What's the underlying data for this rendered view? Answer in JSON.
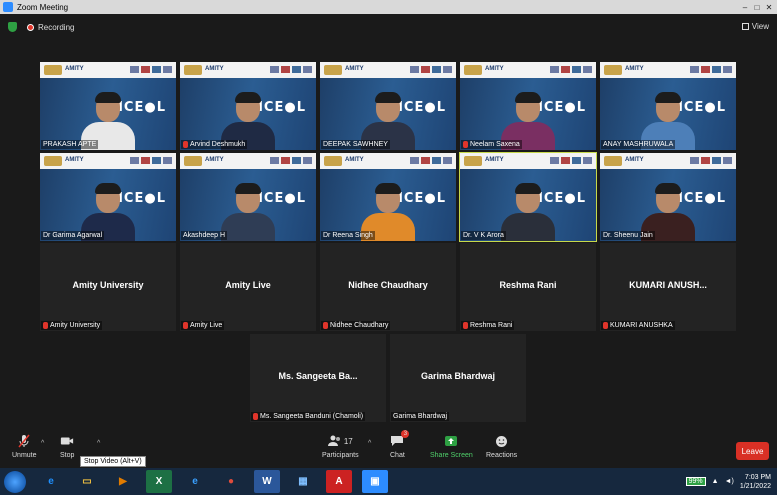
{
  "window": {
    "title": "Zoom Meeting"
  },
  "topbar": {
    "recording_label": "Recording",
    "view_label": "View"
  },
  "tiles": [
    {
      "name": "PRAKASH APTE",
      "type": "video",
      "muted": false,
      "shirt": "#e8e8e8"
    },
    {
      "name": "Arvind Deshmukh",
      "type": "video",
      "muted": true,
      "shirt": "#1f2a44"
    },
    {
      "name": "DEEPAK SAWHNEY",
      "type": "video",
      "muted": false,
      "shirt": "#2b3347"
    },
    {
      "name": "Neelam Saxena",
      "type": "video",
      "muted": true,
      "shirt": "#7a2f62"
    },
    {
      "name": "ANAY MASHRUWALA",
      "type": "video",
      "muted": false,
      "shirt": "#4d7fb8"
    },
    {
      "name": "Dr Garima Agarwal",
      "type": "video",
      "muted": false,
      "shirt": "#1e2a4a"
    },
    {
      "name": "Akashdeep H",
      "type": "video",
      "muted": false,
      "shirt": "#2f3d55"
    },
    {
      "name": "Dr Reena Singh",
      "type": "video",
      "muted": false,
      "shirt": "#e08a2a"
    },
    {
      "name": "Dr. V K Arora",
      "type": "video",
      "muted": false,
      "shirt": "#2a2f3a",
      "active": true
    },
    {
      "name": "Dr. Sheenu Jain",
      "type": "video",
      "muted": false,
      "shirt": "#3a2020"
    },
    {
      "name": "Amity University",
      "display": "Amity University",
      "type": "name",
      "muted": true
    },
    {
      "name": "Amity Live",
      "display": "Amity Live",
      "type": "name",
      "muted": true
    },
    {
      "name": "Nidhee Chaudhary",
      "display": "Nidhee Chaudhary",
      "type": "name",
      "muted": true
    },
    {
      "name": "Reshma Rani",
      "display": "Reshma Rani",
      "type": "name",
      "muted": true
    },
    {
      "name": "KUMARI ANUSHKA",
      "display": "KUMARI ANUSH...",
      "type": "name",
      "muted": true
    },
    {
      "name": "Ms. Sangeeta Banduni (Chamoli)",
      "display": "Ms. Sangeeta Ba...",
      "type": "name",
      "muted": true
    },
    {
      "name": "Garima Bhardwaj",
      "display": "Garima Bhardwaj",
      "type": "name",
      "muted": false
    }
  ],
  "banner": {
    "brand": "AMITY",
    "event": "ICE",
    "event_suffix": "L"
  },
  "controls": {
    "unmute": "Unmute",
    "stop_video": "Stop",
    "participants": "Participants",
    "participants_count": "17",
    "chat": "Chat",
    "chat_badge": "3",
    "share_screen": "Share Screen",
    "reactions": "Reactions",
    "leave": "Leave"
  },
  "tooltip": "Stop Video (Alt+V)",
  "taskbar": {
    "apps": [
      {
        "label": "e",
        "color": "#1e90ff",
        "bg": "transparent",
        "name": "ie-icon"
      },
      {
        "label": "▭",
        "color": "#f0c040",
        "bg": "transparent",
        "name": "folder-icon"
      },
      {
        "label": "▶",
        "color": "#e07b00",
        "bg": "transparent",
        "name": "media-player-icon"
      },
      {
        "label": "X",
        "color": "#fff",
        "bg": "#1d7044",
        "name": "excel-icon"
      },
      {
        "label": "e",
        "color": "#3aa0ff",
        "bg": "transparent",
        "name": "edge-icon"
      },
      {
        "label": "●",
        "color": "#e04c3c",
        "bg": "transparent",
        "name": "chrome-icon"
      },
      {
        "label": "W",
        "color": "#fff",
        "bg": "#2b579a",
        "name": "word-icon"
      },
      {
        "label": "▦",
        "color": "#7fbfff",
        "bg": "transparent",
        "name": "app-icon"
      },
      {
        "label": "A",
        "color": "#fff",
        "bg": "#c22",
        "name": "acrobat-icon"
      },
      {
        "label": "▣",
        "color": "#fff",
        "bg": "#2d8cff",
        "name": "zoom-icon"
      }
    ],
    "battery": "99%",
    "time": "7:03 PM",
    "date": "1/21/2022"
  },
  "colors": {
    "leave": "#d93025",
    "active_border": "#c7d94a",
    "share": "#2ea043"
  }
}
